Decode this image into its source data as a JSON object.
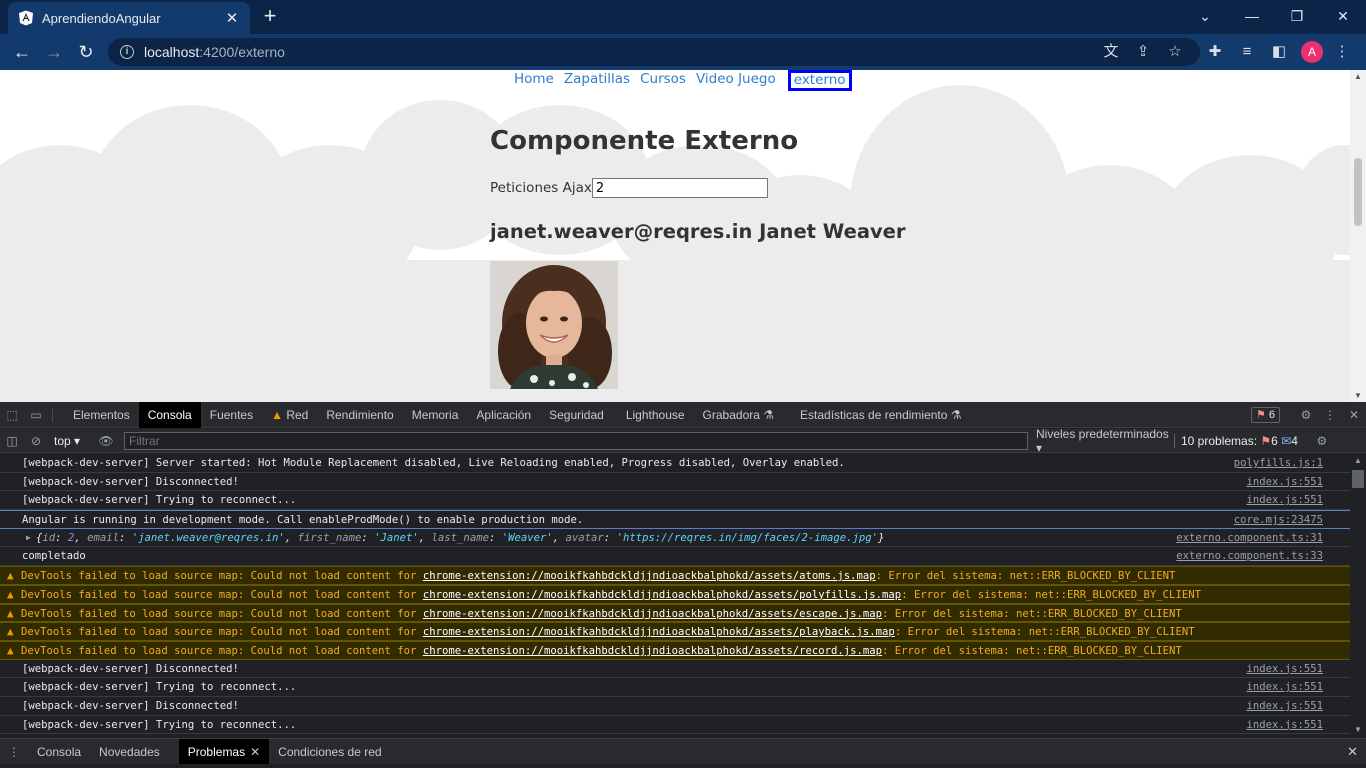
{
  "browser": {
    "tab_title": "AprendiendoAngular",
    "url_host": "localhost",
    "url_path": ":4200/externo"
  },
  "profile_initial": "A",
  "app": {
    "nav": [
      "Home",
      "Zapatillas",
      "Cursos",
      "Video Juego",
      "externo"
    ],
    "active_nav": "externo",
    "title": "Componente Externo",
    "ajax_label": "Peticiones Ajax",
    "ajax_value": "2",
    "user_heading": "janet.weaver@reqres.in Janet Weaver"
  },
  "devtools": {
    "tabs": [
      "Elementos",
      "Consola",
      "Fuentes",
      "Red",
      "Rendimiento",
      "Memoria",
      "Aplicación",
      "Seguridad",
      "Lighthouse",
      "Grabadora",
      "Estadísticas de rendimiento"
    ],
    "active_tab": "Consola",
    "error_count": "6",
    "context": "top",
    "filter_placeholder": "Filtrar",
    "levels": "Niveles predeterminados",
    "problems_label": "10 problemas:",
    "problems_errors": "6",
    "problems_info": "4",
    "drawer_tabs": [
      "Consola",
      "Novedades",
      "Problemas",
      "Condiciones de red"
    ],
    "drawer_active": "Problemas"
  },
  "console": {
    "lines": [
      {
        "text": "[webpack-dev-server] Server started: Hot Module Replacement disabled, Live Reloading enabled, Progress disabled, Overlay enabled.",
        "src": "polyfills.js:1"
      },
      {
        "text": "[webpack-dev-server] Disconnected!",
        "src": "index.js:551"
      },
      {
        "text": "[webpack-dev-server] Trying to reconnect...",
        "src": "index.js:551"
      }
    ],
    "angular": {
      "text": "Angular is running in development mode. Call enableProdMode() to enable production mode.",
      "src": "core.mjs:23475"
    },
    "object": {
      "id": "2",
      "email": "'janet.weaver@reqres.in'",
      "first_name": "'Janet'",
      "last_name": "'Weaver'",
      "avatar": "'https://reqres.in/img/faces/2-image.jpg'",
      "src": "externo.component.ts:31"
    },
    "completado": {
      "text": "completado",
      "src": "externo.component.ts:33"
    },
    "warning_prefix": "DevTools failed to load source map: Could not load content for",
    "warning_suffix": ": Error del sistema: net::ERR_BLOCKED_BY_CLIENT",
    "warnings": [
      "chrome-extension://mooikfkahbdckldjjndioackbalphokd/assets/atoms.js.map",
      "chrome-extension://mooikfkahbdckldjjndioackbalphokd/assets/polyfills.js.map",
      "chrome-extension://mooikfkahbdckldjjndioackbalphokd/assets/escape.js.map",
      "chrome-extension://mooikfkahbdckldjjndioackbalphokd/assets/playback.js.map",
      "chrome-extension://mooikfkahbdckldjjndioackbalphokd/assets/record.js.map"
    ],
    "tail": [
      {
        "text": "[webpack-dev-server] Disconnected!",
        "src": "index.js:551"
      },
      {
        "text": "[webpack-dev-server] Trying to reconnect...",
        "src": "index.js:551"
      },
      {
        "text": "[webpack-dev-server] Disconnected!",
        "src": "index.js:551"
      },
      {
        "text": "[webpack-dev-server] Trying to reconnect...",
        "src": "index.js:551"
      }
    ]
  }
}
